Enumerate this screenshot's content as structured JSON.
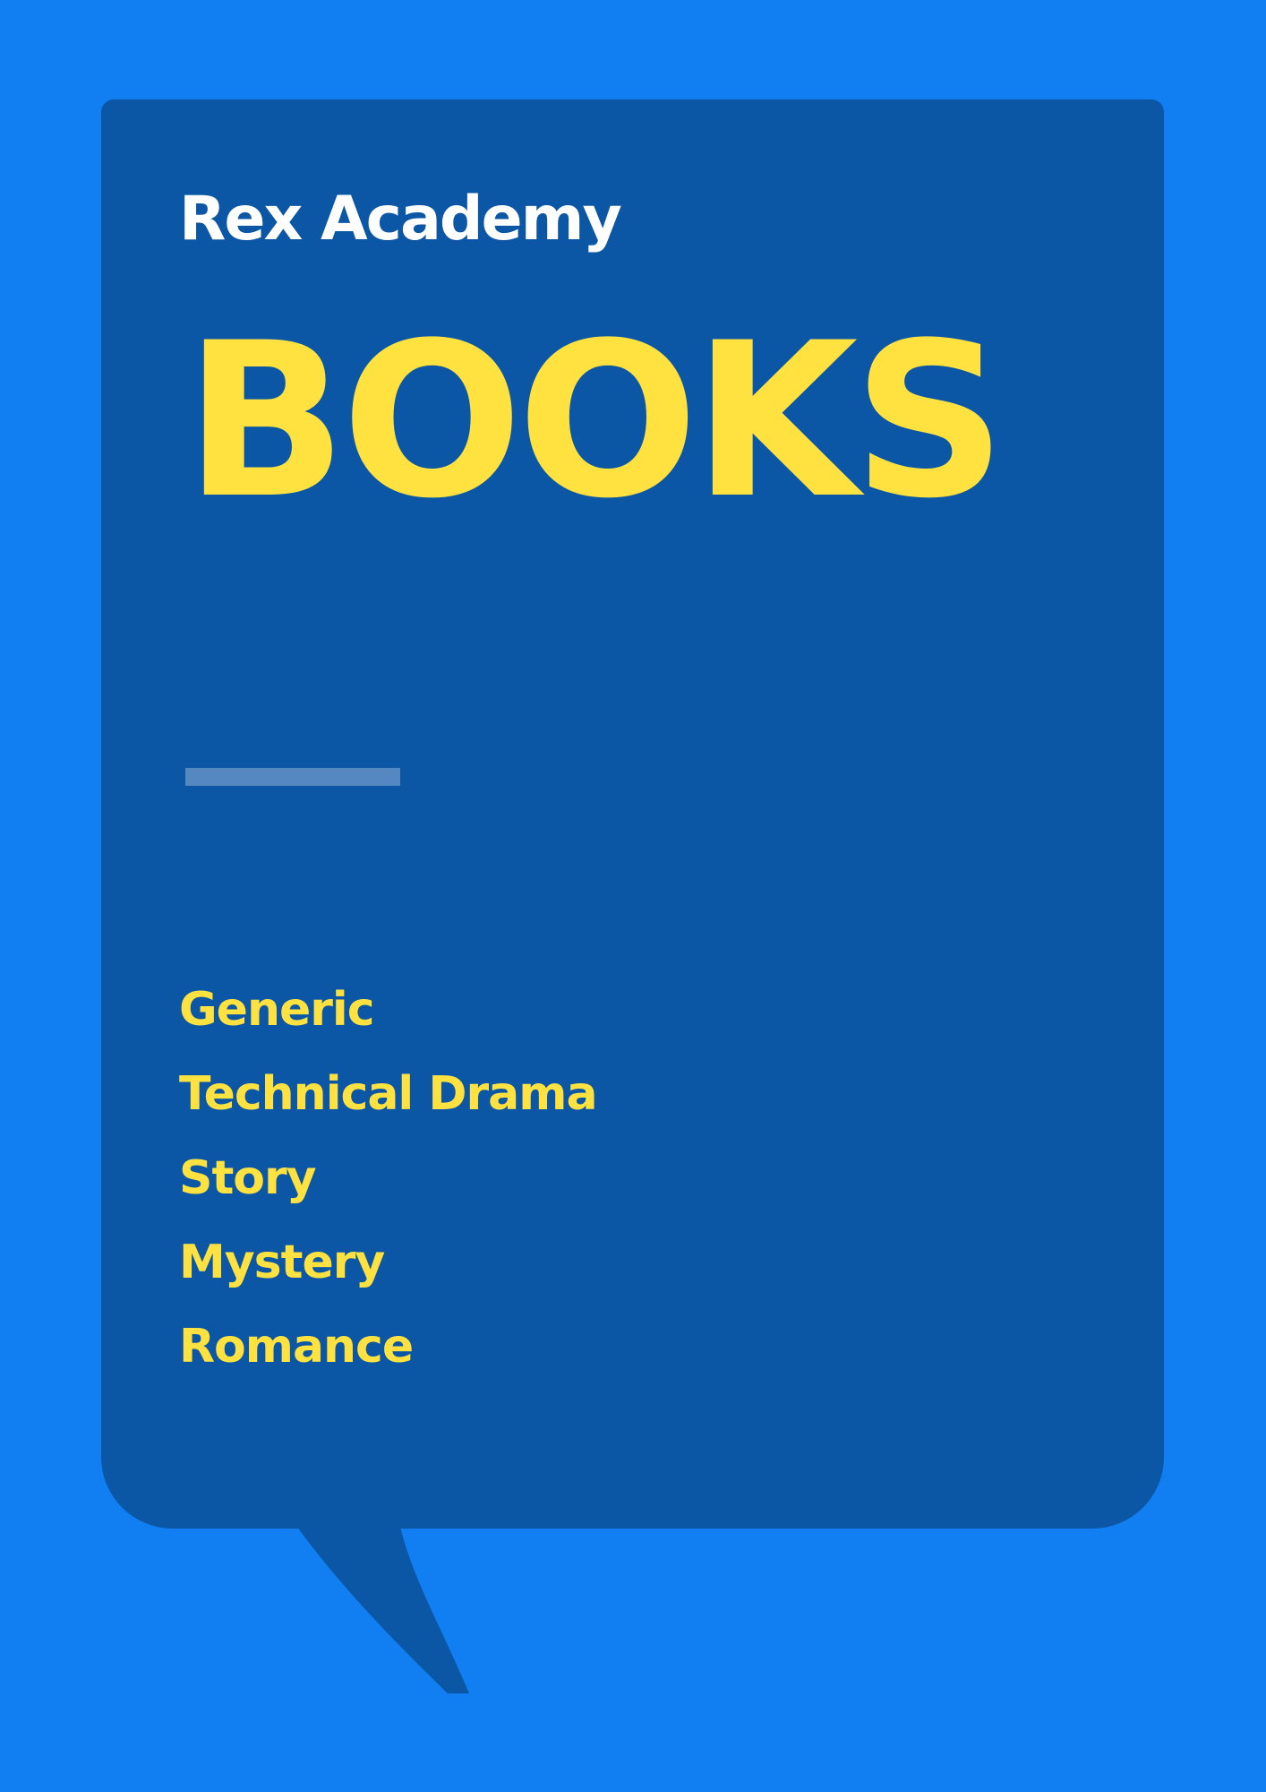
{
  "brand": "Rex Academy",
  "title": "BOOKS",
  "genres": [
    "Generic",
    "Technical Drama",
    "Story",
    "Mystery",
    "Romance"
  ],
  "colors": {
    "background": "#117EF2",
    "bubble": "#0B57A5",
    "accent": "#FFE240",
    "divider": "#5588C0"
  }
}
